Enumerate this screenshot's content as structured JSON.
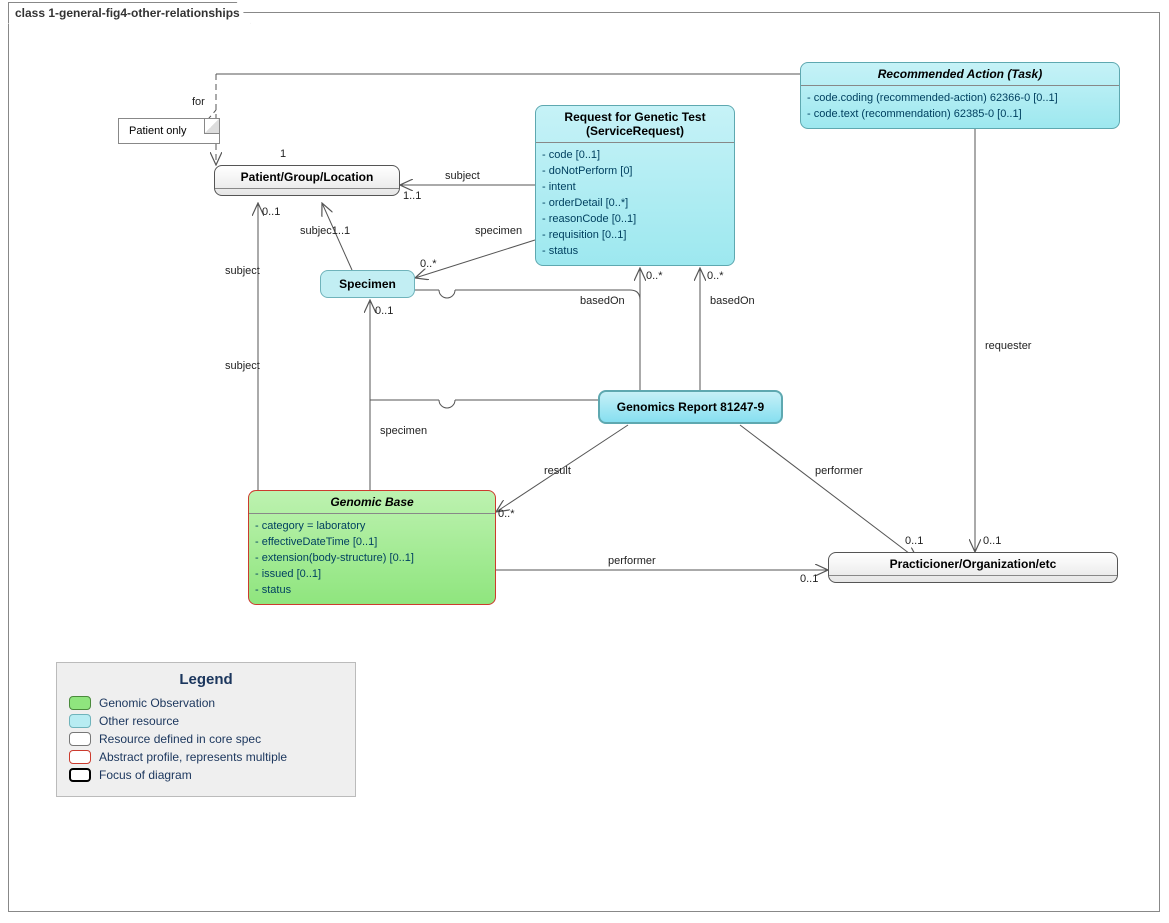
{
  "frame": {
    "title": "class 1-general-fig4-other-relationships"
  },
  "note": {
    "text": "Patient only"
  },
  "boxes": {
    "pgl": {
      "title": "Patient/Group/Location"
    },
    "specimen": {
      "title": "Specimen"
    },
    "serviceRequest": {
      "title1": "Request for Genetic Test",
      "title2": "(ServiceRequest)",
      "attrs": [
        "code [0..1]",
        "doNotPerform [0]",
        "intent",
        "orderDetail [0..*]",
        "reasonCode [0..1]",
        "requisition [0..1]",
        "status"
      ]
    },
    "recommendedAction": {
      "title": "Recommended Action (Task)",
      "attrs": [
        "code.coding (recommended-action) 62366-0 [0..1]",
        "code.text (recommendation) 62385-0 [0..1]"
      ]
    },
    "genomicsReport": {
      "title": "Genomics Report 81247-9"
    },
    "genomicBase": {
      "title": "Genomic Base",
      "attrs": [
        "category = laboratory",
        "effectiveDateTime [0..1]",
        "extension(body-structure) [0..1]",
        "issued [0..1]",
        "status"
      ]
    },
    "practitioner": {
      "title": "Practicioner/Organization/etc"
    }
  },
  "edgeLabels": {
    "for": "for",
    "subject1": "subject",
    "subject2": "subject",
    "subject3": "subject",
    "specimenSR": "specimen",
    "specimenGB": "specimen",
    "basedOn1": "basedOn",
    "basedOn2": "basedOn",
    "result": "result",
    "performer1": "performer",
    "performer2": "performer",
    "requester": "requester"
  },
  "mult": {
    "pgl_one": "1",
    "pgl_subj": "1..1",
    "pgl_small": "0..1",
    "spec_subj": "subjec1..1",
    "spec_sr": "0..*",
    "spec_gb": "0..1",
    "sr_based": "0..*",
    "sr_based2": "0..*",
    "gb_result": "0..*",
    "prac1": "0..1",
    "prac1b": "0..1",
    "prac_perf": "0..1"
  },
  "legend": {
    "title": "Legend",
    "rows": [
      "Genomic Observation",
      "Other resource",
      "Resource defined in core spec",
      "Abstract profile, represents multiple",
      "Focus of diagram"
    ]
  }
}
